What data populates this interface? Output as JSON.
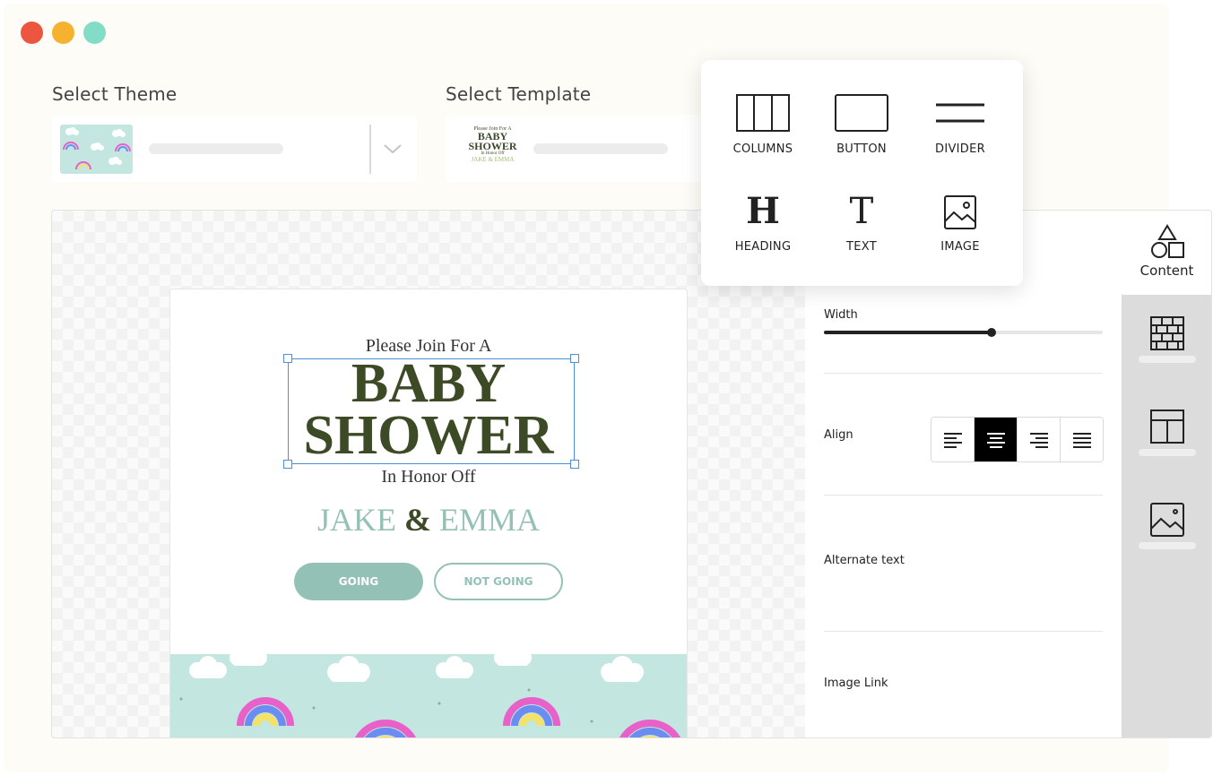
{
  "theme_section": {
    "label": "Select Theme"
  },
  "template_section": {
    "label": "Select Template",
    "thumbnail": {
      "line1": "Please Join For A",
      "line2": "BABY",
      "line3": "SHOWER",
      "line4": "In Honor Off",
      "line5": "JAKE & EMMA"
    }
  },
  "email": {
    "intro": "Please Join For A",
    "title_line1": "BABY",
    "title_line2": "SHOWER",
    "honor": "In Honor Off",
    "name1": "JAKE",
    "amp": "&",
    "name2": "EMMA",
    "going_label": "GOING",
    "not_going_label": "NOT GOING"
  },
  "tools": {
    "columns": "COLUMNS",
    "button": "BUTTON",
    "divider": "DIVIDER",
    "heading": "HEADING",
    "text": "TEXT",
    "image": "IMAGE",
    "heading_glyph": "H",
    "text_glyph": "T"
  },
  "properties": {
    "width_label": "Width",
    "width_value": 0.6,
    "align_label": "Align",
    "align_selected": "center",
    "alt_text_label": "Alternate text",
    "image_link_label": "Image Link"
  },
  "sidebar": {
    "content_label": "Content",
    "tabs": [
      "content",
      "blocks",
      "layout",
      "images"
    ]
  },
  "colors": {
    "accent_green": "#93c1b6",
    "title_olive": "#3d4a26",
    "selection_blue": "#4e8fd8"
  }
}
